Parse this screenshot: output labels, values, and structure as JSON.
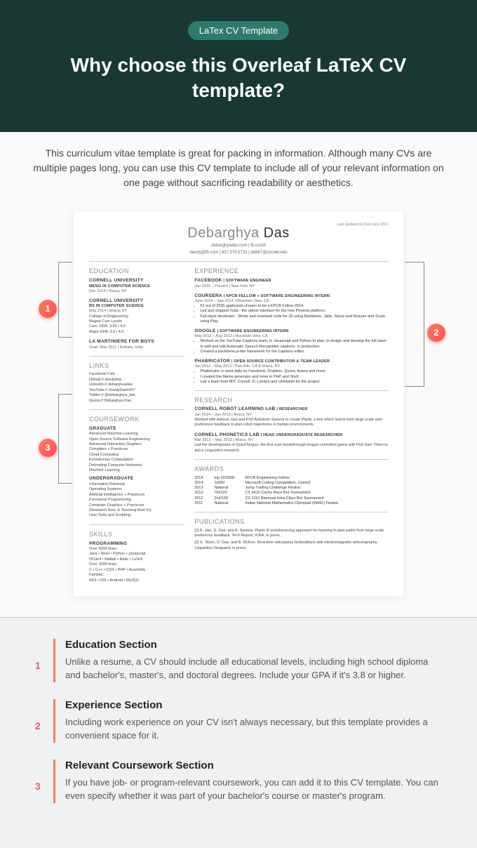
{
  "hero": {
    "badge": "LaTex CV Template",
    "title": "Why choose this Overleaf LaTeX CV template?"
  },
  "intro": "This curriculum vitae template is great for packing in information. Although many CVs are multiple pages long, you can use this CV template to include all of your relevant information on one page without sacrificing readability or aesthetics.",
  "markers": {
    "m1": "1",
    "m2": "2",
    "m3": "3"
  },
  "cv": {
    "updated": "Last Updated on 21st June 2019",
    "name_first": "Debarghya",
    "name_last": "Das",
    "contact1": "debarghyadas.com | fb.co/dd",
    "contact2": "deedy@fb.com | 607.379.5733 | dd367@cornell.edu",
    "education": {
      "title": "EDUCATION",
      "items": [
        {
          "school": "CORNELL UNIVERSITY",
          "degree": "MENG IN COMPUTER SCIENCE",
          "meta": "Dec 2014 | Ithaca, NY"
        },
        {
          "school": "CORNELL UNIVERSITY",
          "degree": "BS IN COMPUTER SCIENCE",
          "meta": "May 2014 | Ithaca, NY",
          "extra": "College of Engineering\nMagna Cum Laude\nCum. GPA: 3.83 / 4.0\nMajor GPA: 3.9 / 4.0"
        },
        {
          "school": "LA MARTINIERE FOR BOYS",
          "meta": "Grad. May 2011 | Kolkata, India"
        }
      ]
    },
    "links": {
      "title": "LINKS",
      "body": "Facebook:// dd\nGithub:// deedydas\nLinkedIn:// debarghyadas\nYouTube:// DeedyDash007\nTwitter:// @debarghya_das\nQuora:// Debarghya-Das"
    },
    "coursework": {
      "title": "COURSEWORK",
      "grad_title": "GRADUATE",
      "grad": "Advanced Machine Learning\nOpen Source Software Engineering\nAdvanced Interactive Graphics\nCompilers + Practicum\nCloud Computing\nEvolutionary Computation\nDefending Computer Networks\nMachine Learning",
      "ugrad_title": "UNDERGRADUATE",
      "ugrad": "Information Retrieval\nOperating Systems\nArtificial Intelligence + Practicum\nFunctional Programming\nComputer Graphics + Practicum\n(Research Asst. & Teaching Asst 2x)\nUnix Tools and Scripting"
    },
    "skills": {
      "title": "SKILLS",
      "sub": "PROGRAMMING",
      "body": "Over 5000 lines:\nJava • Shell • Python • Javascript\nOCaml • Matlab • Rails • LaTeX\nOver 1000 lines:\nC • C++ • CSS • PHP • Assembly\nFamiliar:\nAS3 • iOS • Android • MySQL"
    },
    "experience": {
      "title": "EXPERIENCE",
      "items": [
        {
          "company": "FACEBOOK",
          "role": "| SOFTWARE ENGINEER",
          "meta": "Jan 2015 – Present | New York, NY"
        },
        {
          "company": "COURSERA",
          "role": "| KPCB FELLOW + SOFTWARE ENGINEERING INTERN",
          "meta": "June 2014 – Sep 2014 | Mountain View, CA",
          "bullets": [
            "52 out of 2500 applicants chosen to be a KPCB Fellow 2014.",
            "Led and shipped Yoda - the admin interface for the new Phoenix platform.",
            "Full-stack developer - Wrote and reviewed code for JS using Backbone, Jade, Stylus and Require and Scala using Play"
          ]
        },
        {
          "company": "GOOGLE",
          "role": "| SOFTWARE ENGINEERING INTERN",
          "meta": "May 2013 – Aug 2013 | Mountain View, CA",
          "bullets": [
            "Worked on the YouTube Captions team, in Javascript and Python to plan, to design and develop the full stack to add and edit Automatic Speech Recognition captions. In production.",
            "Created a backbone.js-like framework for the Captions editor."
          ]
        },
        {
          "company": "PHABRICATOR",
          "role": "| OPEN SOURCE CONTRIBUTOR & TEAM LEADER",
          "meta": "Jan 2013 – May 2013 | Palo Alto, CA & Ithaca, NY",
          "bullets": [
            "Phabricator is used daily by Facebook, Dropbox, Quora, Asana and more.",
            "I created the Meme generator and more in PHP and Shell.",
            "Led a team from MIT, Cornell, IC London and UHelsinki for the project."
          ]
        }
      ]
    },
    "research": {
      "title": "RESEARCH",
      "items": [
        {
          "lab": "CORNELL ROBOT LEARNING LAB",
          "role": "| RESEARCHER",
          "meta": "Jan 2014 – Jan 2015 | Ithaca, NY",
          "body": "Worked with Ashesh Jain and Prof Ashutosh Saxena to create PlanIt, a tool which learns from large scale user preference feedback to plan robot trajectories in human environments."
        },
        {
          "lab": "CORNELL PHONETICS LAB",
          "role": "| HEAD UNDERGRADUATE RESEARCHER",
          "meta": "Mar 2012 – May 2013 | Ithaca, NY",
          "body": "Led the development of QuickTongue, the first ever breakthrough tongue-controlled game with Prof Sam Tilsen to aid in Linguistics research."
        }
      ]
    },
    "awards": {
      "title": "AWARDS",
      "rows": [
        {
          "y": "2014",
          "r": "top 52/2500",
          "d": "KPCB Engineering Fellow"
        },
        {
          "y": "2014",
          "r": "1st/50",
          "d": "Microsoft Coding Competition, Cornell"
        },
        {
          "y": "2013",
          "r": "National",
          "d": "Jump Trading Challenge Finalist"
        },
        {
          "y": "2013",
          "r": "7th/120",
          "d": "CS 3410 Cache Race Bot Tournament"
        },
        {
          "y": "2012",
          "r": "2nd/150",
          "d": "CS 3110 Biannual Intra-Class Bot Tournament"
        },
        {
          "y": "2011",
          "r": "National",
          "d": "Indian National Mathematics Olympiad (INMO) Finalist"
        }
      ]
    },
    "publications": {
      "title": "PUBLICATIONS",
      "items": [
        "[1]  A. Jain, D. Das, and A. Saxena. Planit: A crowdsourcing approach for learning to plan paths from large scale preference feedback. Tech Report, ICRA, in press.",
        "[2]  S. Tilsen, D. Das, and B. McKee. Real-time articulatory biofeedback with electromagnetic articulography. Linguistics Vanguard, in press."
      ]
    }
  },
  "explain": [
    {
      "num": "1",
      "title": "Education Section",
      "text": "Unlike a resume, a CV should include all educational levels, including high school diploma and bachelor's, master's, and doctoral degrees. Include your GPA if it's 3.8 or higher."
    },
    {
      "num": "2",
      "title": "Experience Section",
      "text": "Including work experience on your CV isn't always necessary, but this template provides a convenient space for it."
    },
    {
      "num": "3",
      "title": "Relevant Coursework Section",
      "text": "If you have job- or program-relevant coursework, you can add it to this CV template. You can even specify whether it was part of your bachelor's course or master's program."
    }
  ]
}
